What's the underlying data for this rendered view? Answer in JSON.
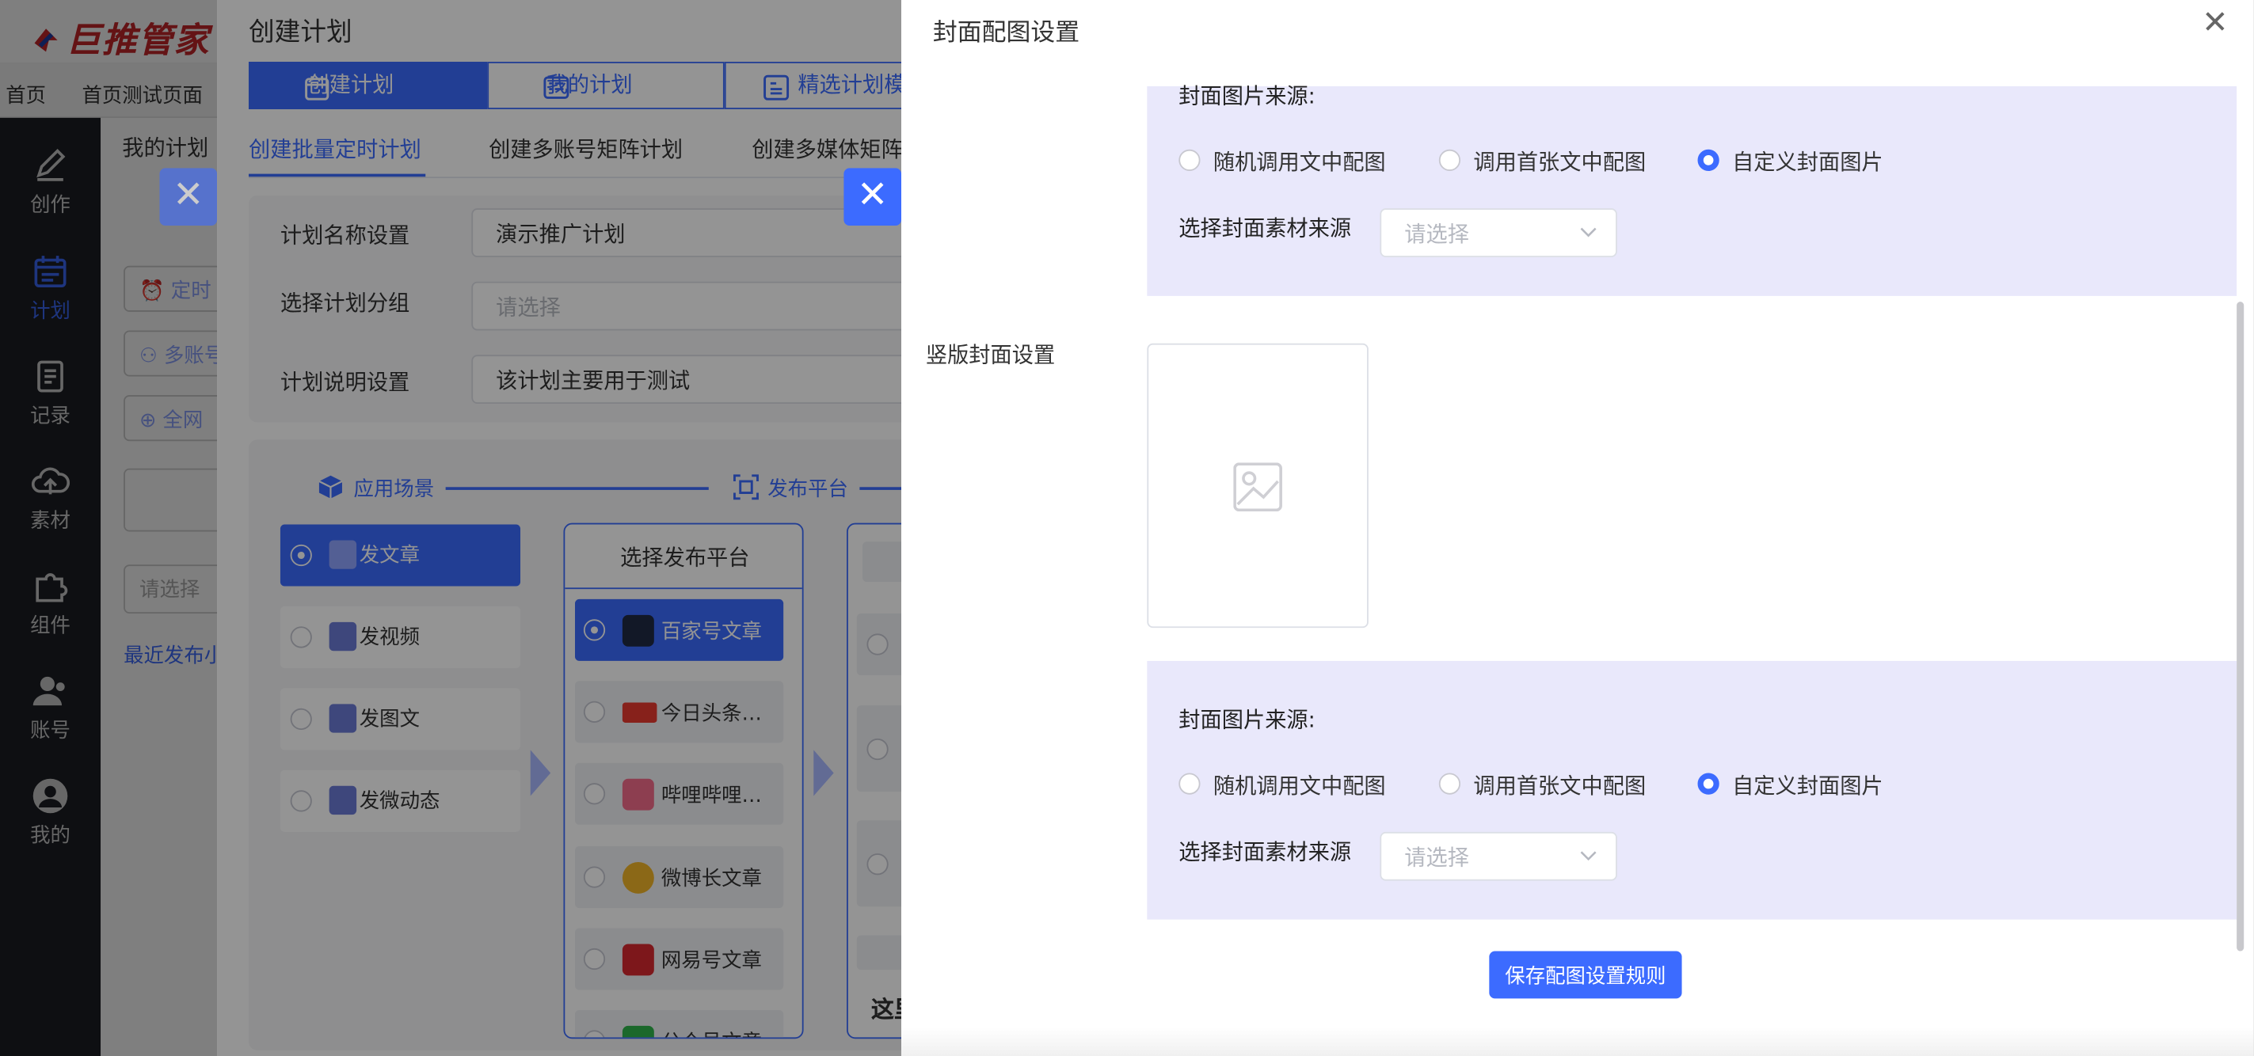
{
  "app": {
    "logo_text": "巨推管家"
  },
  "breadcrumb": {
    "home": "首页",
    "page": "首页测试页面"
  },
  "left_nav": [
    {
      "label": "创作",
      "icon": "pen-icon"
    },
    {
      "label": "计划",
      "icon": "calendar-icon"
    },
    {
      "label": "记录",
      "icon": "record-icon"
    },
    {
      "label": "素材",
      "icon": "cloud-icon"
    },
    {
      "label": "组件",
      "icon": "puzzle-icon"
    },
    {
      "label": "账号",
      "icon": "users-icon"
    },
    {
      "label": "我的",
      "icon": "user-icon"
    }
  ],
  "background": {
    "my_plans_tab": "我的计划",
    "timer_chip": "定时",
    "multi_chip": "多账号",
    "all_chip": "全网",
    "select_placeholder": "请选择",
    "recent_link": "最近发布小"
  },
  "plan_modal": {
    "title": "创建计划",
    "tabs": [
      "创建计划",
      "我的计划",
      "精选计划模"
    ],
    "subtabs": [
      "创建批量定时计划",
      "创建多账号矩阵计划",
      "创建多媒体矩阵"
    ],
    "form": {
      "name_label": "计划名称设置",
      "name_value": "演示推广计划",
      "group_label": "选择计划分组",
      "group_placeholder": "请选择",
      "desc_label": "计划说明设置",
      "desc_value": "该计划主要用于测试"
    },
    "steps": [
      "应用场景",
      "发布平台"
    ],
    "scenes": [
      "发文章",
      "发视频",
      "发图文",
      "发微动态"
    ],
    "platform_title": "选择发布平台",
    "platforms": [
      "百家号文章",
      "今日头条…",
      "哔哩哔哩…",
      "微博长文章",
      "网易号文章",
      "公众号文章"
    ],
    "third_col_text": "这里"
  },
  "drawer": {
    "title": "封面配图设置",
    "cover_source_title": "封面图片来源:",
    "options": [
      "随机调用文中配图",
      "调用首张文中配图",
      "自定义封面图片"
    ],
    "material_label": "选择封面素材来源",
    "material_placeholder": "请选择",
    "vertical_label": "竖版封面设置",
    "save_button": "保存配图设置规则"
  },
  "colors": {
    "accent": "#3c6bff",
    "panel_bg": "#e9e8fb",
    "nav_bg": "#1c1f24",
    "logo_red": "#c8262b"
  }
}
